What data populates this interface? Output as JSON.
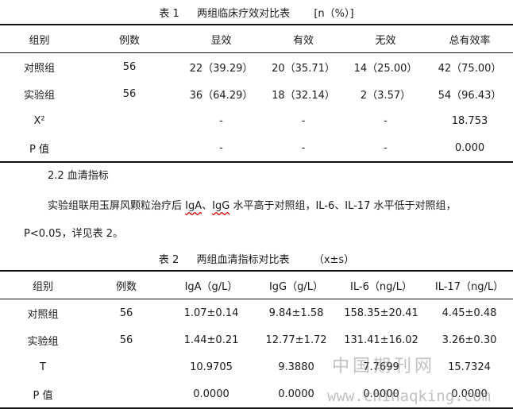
{
  "table1": {
    "caption_label": "表 1",
    "caption_title": "两组临床疗效对比表",
    "caption_unit": "[n（%）]",
    "headers": [
      "组别",
      "例数",
      "显效",
      "有效",
      "无效",
      "总有效率"
    ],
    "rows": [
      [
        "对照组",
        "56",
        "22（39.29）",
        "20（35.71）",
        "14（25.00）",
        "42（75.00）"
      ],
      [
        "实验组",
        "56",
        "36（64.29）",
        "18（32.14）",
        "2（3.57）",
        "54（96.43）"
      ],
      [
        "X²",
        "",
        "-",
        "-",
        "-",
        "18.753"
      ],
      [
        "P 值",
        "",
        "-",
        "-",
        "-",
        "0.000"
      ]
    ]
  },
  "section": {
    "heading": "2.2 血清指标",
    "para_line1_a": "实验组联用玉屏风颗粒治疗后",
    "para_line1_iga": "IgA",
    "para_line1_sep": "、",
    "para_line1_igg": "IgG",
    "para_line1_b": "水平高于对照组，IL-6、IL-17 水平低于对照组，",
    "para_line2": "P<0.05，详见表 2。"
  },
  "table2": {
    "caption_label": "表 2",
    "caption_title": "两组血清指标对比表",
    "caption_unit": "（x±s）",
    "headers": [
      "组别",
      "例数",
      "IgA（g/L）",
      "IgG（g/L）",
      "IL-6（ng/L）",
      "IL-17（ng/L）"
    ],
    "rows": [
      [
        "对照组",
        "56",
        "1.07±0.14",
        "9.84±1.58",
        "158.35±20.41",
        "4.45±0.48"
      ],
      [
        "实验组",
        "56",
        "1.44±0.21",
        "12.77±1.72",
        "131.41±16.02",
        "3.26±0.30"
      ],
      [
        "T",
        "",
        "10.9705",
        "9.3880",
        "7.7699",
        "15.7324"
      ],
      [
        "P 值",
        "",
        "0.0000",
        "0.0000",
        "0.0000",
        "0.0000"
      ]
    ]
  },
  "watermark": {
    "text_cn": "中国期刊网",
    "text_url": "www.chinaqking.com"
  }
}
